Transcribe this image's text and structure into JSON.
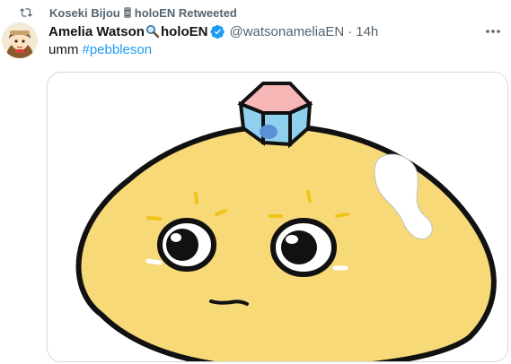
{
  "retweet": {
    "retweeter_name": "Koseki Bijou",
    "retweeter_suffix": "holoEN Retweeted",
    "icon": "retweet-icon",
    "emoji": "moai-emoji"
  },
  "tweet": {
    "display_name": "Amelia Watson",
    "name_emoji": "magnifying-glass-emoji",
    "name_suffix": "holoEN",
    "verified": true,
    "handle": "@watsonameliaEN",
    "separator": "·",
    "time": "14h",
    "text_prefix": "umm ",
    "hashtag": "#pebbleson"
  },
  "colors": {
    "accent": "#1d9bf0",
    "secondary_text": "#536471",
    "primary_text": "#0f1419",
    "border": "#cfd9de",
    "pebble_fill": "#f7d978"
  }
}
